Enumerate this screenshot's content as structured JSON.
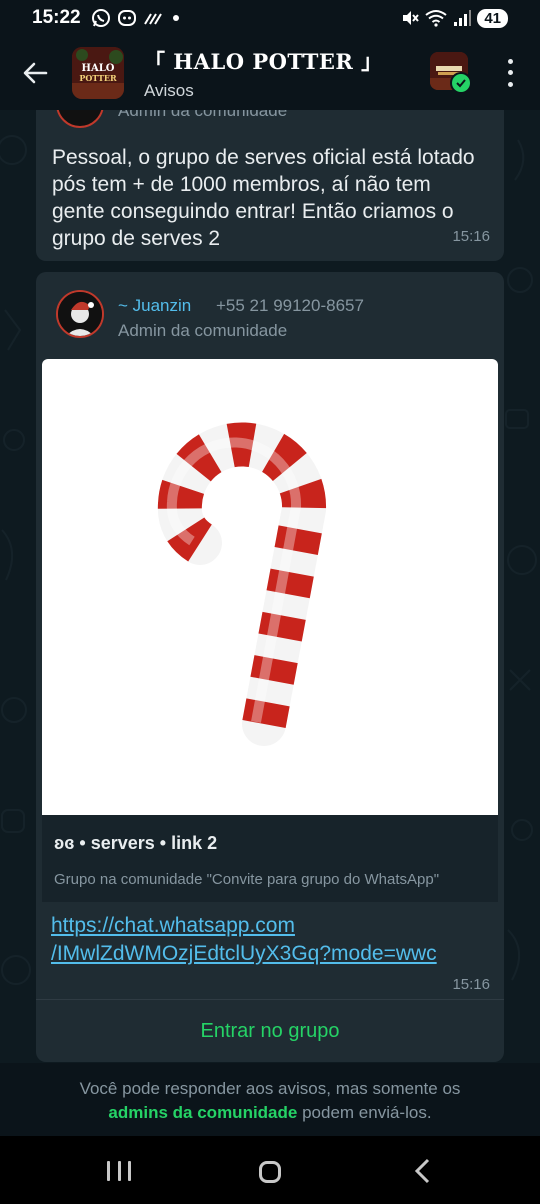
{
  "status_bar": {
    "time": "15:22",
    "battery": "41",
    "icons": [
      "whatsapp-icon",
      "discord-icon",
      "signal-icon",
      "dot-icon",
      "mute-icon",
      "wifi-icon",
      "cell-signal-icon"
    ]
  },
  "header": {
    "title": "「 HALO POTTER 」",
    "subtitle": "Avisos",
    "avatar_text": [
      "HALO",
      "POTTER"
    ]
  },
  "messages": [
    {
      "role": "Admin da comunidade",
      "text": "Pessoal, o grupo de serves oficial está lotado pós tem + de 1000 membros, aí não tem gente conseguindo entrar! Então criamos o grupo de serves 2",
      "time": "15:16"
    },
    {
      "sender_name": "~ Juanzin",
      "sender_phone": "+55 21 99120-8657",
      "role": "Admin da comunidade",
      "preview_title": "ʚɞ • servers • link 2",
      "preview_desc": "Grupo na comunidade \"Convite para grupo do WhatsApp\"",
      "link_line1": "https://chat.whatsapp.com",
      "link_line2": "/IMwlZdWMOzjEdtclUyX3Gq?mode=wwc",
      "time": "15:16",
      "join_label": "Entrar no grupo"
    }
  ],
  "footer": {
    "text_before": "Você pode responder aos avisos, mas somente os",
    "text_bold": "admins da comunidade",
    "text_after": "podem enviá-los."
  },
  "colors": {
    "accent_green": "#25d366",
    "link_blue": "#53bdeb",
    "bubble_bg": "#1f2c33",
    "background": "#0b141a"
  }
}
